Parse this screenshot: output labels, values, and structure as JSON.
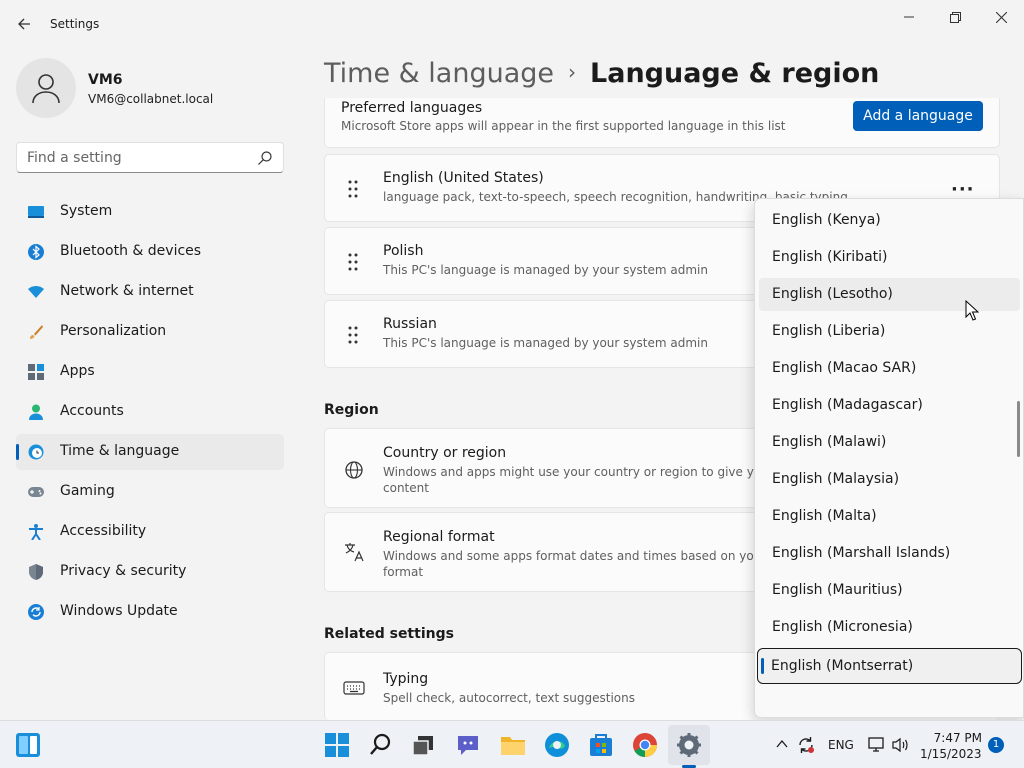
{
  "window": {
    "title": "Settings"
  },
  "profile": {
    "name": "VM6",
    "email": "VM6@collabnet.local"
  },
  "search": {
    "placeholder": "Find a setting"
  },
  "sidebar": {
    "items": [
      {
        "label": "System",
        "icon": "monitor-icon"
      },
      {
        "label": "Bluetooth & devices",
        "icon": "bluetooth-icon"
      },
      {
        "label": "Network & internet",
        "icon": "wifi-icon"
      },
      {
        "label": "Personalization",
        "icon": "brush-icon"
      },
      {
        "label": "Apps",
        "icon": "apps-icon"
      },
      {
        "label": "Accounts",
        "icon": "person-icon"
      },
      {
        "label": "Time & language",
        "icon": "globe-clock-icon",
        "active": true
      },
      {
        "label": "Gaming",
        "icon": "gamepad-icon"
      },
      {
        "label": "Accessibility",
        "icon": "accessibility-icon"
      },
      {
        "label": "Privacy & security",
        "icon": "shield-icon"
      },
      {
        "label": "Windows Update",
        "icon": "update-icon"
      }
    ]
  },
  "breadcrumb": {
    "parent": "Time & language",
    "separator": "›",
    "current": "Language & region"
  },
  "preferred": {
    "title": "Preferred languages",
    "desc": "Microsoft Store apps will appear in the first supported language in this list",
    "add_button": "Add a language"
  },
  "languages": [
    {
      "name": "English (United States)",
      "desc": "language pack, text-to-speech, speech recognition, handwriting, basic typing"
    },
    {
      "name": "Polish",
      "desc": "This PC's language is managed by your system admin"
    },
    {
      "name": "Russian",
      "desc": "This PC's language is managed by your system admin"
    }
  ],
  "region": {
    "heading": "Region",
    "country": {
      "title": "Country or region",
      "desc1": "Windows and apps might use your country or region to give you loca",
      "desc2": "content"
    },
    "format": {
      "title": "Regional format",
      "desc1": "Windows and some apps format dates and times based on your regi",
      "desc2": "format"
    }
  },
  "related": {
    "heading": "Related settings",
    "typing": {
      "title": "Typing",
      "desc": "Spell check, autocorrect, text suggestions"
    }
  },
  "dropdown": {
    "options": [
      "English (Kenya)",
      "English (Kiribati)",
      "English (Lesotho)",
      "English (Liberia)",
      "English (Macao SAR)",
      "English (Madagascar)",
      "English (Malawi)",
      "English (Malaysia)",
      "English (Malta)",
      "English (Marshall Islands)",
      "English (Mauritius)",
      "English (Micronesia)",
      "English (Montserrat)"
    ],
    "hovered": "English (Lesotho)",
    "selected": "English (Montserrat)"
  },
  "taskbar": {
    "apps": [
      "start-icon",
      "search-icon",
      "task-view-icon",
      "chat-icon",
      "file-explorer-icon",
      "edge-icon",
      "store-icon",
      "chrome-icon",
      "settings-icon"
    ],
    "lang": "ENG",
    "time": "7:47 PM",
    "date": "1/15/2023",
    "notifications": "1"
  },
  "colors": {
    "accent": "#005fb8",
    "background": "#f3f3f3",
    "card": "#fbfbfb"
  }
}
